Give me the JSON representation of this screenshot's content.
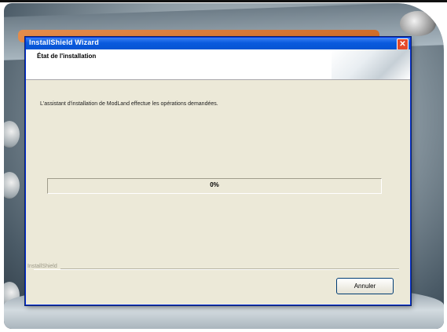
{
  "window": {
    "title": "InstallShield Wizard",
    "close_icon": "close-icon",
    "accent": "#0a5ade"
  },
  "header": {
    "title": "État de l'installation"
  },
  "body": {
    "status_text": "L'assistant d'installation de ModLand effectue les opérations demandées."
  },
  "progress": {
    "value": 0,
    "label": "0%"
  },
  "footer": {
    "brand": "InstallShield",
    "cancel_label": "Annuler"
  }
}
